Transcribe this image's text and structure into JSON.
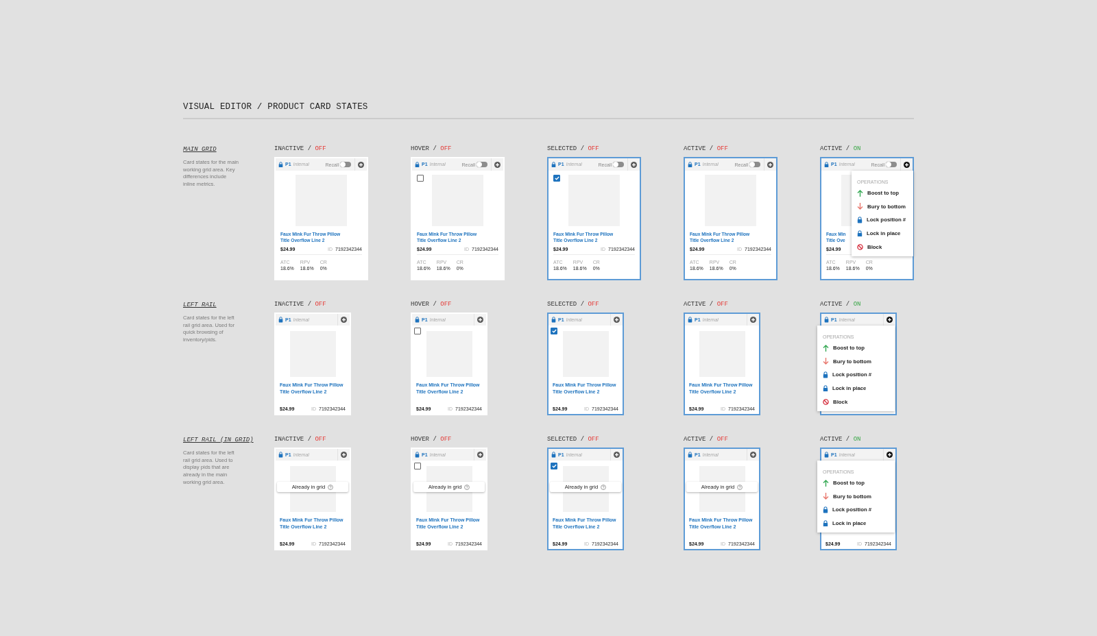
{
  "title": "VISUAL EDITOR / PRODUCT CARD STATES",
  "sections": [
    {
      "kind": "main",
      "name": "MAIN GRID",
      "description": "Card states for the main working grid area. Key differences include inline metrics.",
      "cards": [
        {
          "state": "INACTIVE",
          "divider": "/",
          "status": "OFF",
          "on": false,
          "outlined": false,
          "tag": "P1",
          "tag_note": "Internal",
          "recall": {
            "label": "Recall",
            "on": false
          },
          "title": [
            "Faux Mink Fur Throw Pillow",
            "Title Overflow Line 2"
          ],
          "price": "$24.99",
          "id_label": "ID",
          "id": "7192342344",
          "metrics": [
            {
              "label": "ATC",
              "value": "18.6%"
            },
            {
              "label": "RPV",
              "value": "18.6%"
            },
            {
              "label": "CR",
              "value": "0%"
            }
          ]
        },
        {
          "state": "HOVER",
          "divider": "/",
          "status": "OFF",
          "on": false,
          "outlined": false,
          "checkbox": {
            "checked": false
          },
          "tag": "P1",
          "tag_note": "Internal",
          "recall": {
            "label": "Recall",
            "on": false
          },
          "title": [
            "Faux Mink Fur Throw Pillow",
            "Title Overflow Line 2"
          ],
          "price": "$24.99",
          "id_label": "ID",
          "id": "7192342344",
          "metrics": [
            {
              "label": "ATC",
              "value": "18.6%"
            },
            {
              "label": "RPV",
              "value": "18.6%"
            },
            {
              "label": "CR",
              "value": "0%"
            }
          ]
        },
        {
          "state": "SELECTED",
          "divider": "/",
          "status": "OFF",
          "on": false,
          "outlined": true,
          "checkbox": {
            "checked": true
          },
          "tag": "P1",
          "tag_note": "Internal",
          "recall": {
            "label": "Recall",
            "on": false
          },
          "title": [
            "Faux Mink Fur Throw Pillow",
            "Title Overflow Line 2"
          ],
          "price": "$24.99",
          "id_label": "ID",
          "id": "7192342344",
          "metrics": [
            {
              "label": "ATC",
              "value": "18.6%"
            },
            {
              "label": "RPV",
              "value": "18.6%"
            },
            {
              "label": "CR",
              "value": "0%"
            }
          ]
        },
        {
          "state": "ACTIVE",
          "divider": "/",
          "status": "OFF",
          "on": false,
          "outlined": true,
          "tag": "P1",
          "tag_note": "Internal",
          "recall": {
            "label": "Recall",
            "on": false
          },
          "title": [
            "Faux Mink Fur Throw Pillow",
            "Title Overflow Line 2"
          ],
          "price": "$24.99",
          "id_label": "ID",
          "id": "7192342344",
          "metrics": [
            {
              "label": "ATC",
              "value": "18.6%"
            },
            {
              "label": "RPV",
              "value": "18.6%"
            },
            {
              "label": "CR",
              "value": "0%"
            }
          ]
        },
        {
          "state": "ACTIVE",
          "divider": "/",
          "status": "ON",
          "on": true,
          "outlined": true,
          "tag": "P1",
          "tag_note": "Internal",
          "recall": {
            "label": "Recall",
            "on": false
          },
          "title": [
            "Faux Min",
            "Title Ove"
          ],
          "price": "$24.99",
          "metrics": [
            {
              "label": "ATC",
              "value": "18.6%"
            },
            {
              "label": "RPV",
              "value": "18.6%"
            },
            {
              "label": "CR",
              "value": "0%"
            }
          ],
          "menu": {
            "title": "OPERATIONS",
            "items": [
              {
                "kind": "boost",
                "label": "Boost to top"
              },
              {
                "kind": "bury",
                "label": "Bury to bottom"
              },
              {
                "kind": "lock",
                "label": "Lock position #"
              },
              {
                "kind": "lock",
                "label": "Lock in place"
              },
              {
                "kind": "block",
                "label": "Block"
              }
            ]
          }
        }
      ]
    },
    {
      "kind": "rail",
      "name": "LEFT RAIL",
      "description": "Card states for the left rail grid area. Used for quick browsing of inventory/pids.",
      "cards": [
        {
          "state": "INACTIVE",
          "divider": "/",
          "status": "OFF",
          "on": false,
          "outlined": false,
          "tag": "P1",
          "tag_note": "Internal",
          "title": [
            "Faux Mink Fur Throw Pillow",
            "Title Overflow Line 2"
          ],
          "price": "$24.99",
          "id_label": "ID",
          "id": "7192342344"
        },
        {
          "state": "HOVER",
          "divider": "/",
          "status": "OFF",
          "on": false,
          "outlined": false,
          "checkbox": {
            "checked": false
          },
          "tag": "P1",
          "tag_note": "Internal",
          "title": [
            "Faux Mink Fur Throw Pillow",
            "Title Overflow Line 2"
          ],
          "price": "$24.99",
          "id_label": "ID",
          "id": "7192342344"
        },
        {
          "state": "SELECTED",
          "divider": "/",
          "status": "OFF",
          "on": false,
          "outlined": true,
          "checkbox": {
            "checked": true
          },
          "tag": "P1",
          "tag_note": "Internal",
          "title": [
            "Faux Mink Fur Throw Pillow",
            "Title Overflow Line 2"
          ],
          "price": "$24.99",
          "id_label": "ID",
          "id": "7192342344"
        },
        {
          "state": "ACTIVE",
          "divider": "/",
          "status": "OFF",
          "on": false,
          "outlined": true,
          "tag": "P1",
          "tag_note": "Internal",
          "title": [
            "Faux Mink Fur Throw Pillow",
            "Title Overflow Line 2"
          ],
          "price": "$24.99",
          "id_label": "ID",
          "id": "7192342344"
        },
        {
          "state": "ACTIVE",
          "divider": "/",
          "status": "ON",
          "on": true,
          "outlined": true,
          "tag": "P1",
          "tag_note": "Internal",
          "menu": {
            "title": "OPERATIONS",
            "items": [
              {
                "kind": "boost",
                "label": "Boost to top"
              },
              {
                "kind": "bury",
                "label": "Bury to bottom"
              },
              {
                "kind": "lock",
                "label": "Lock position #"
              },
              {
                "kind": "lock",
                "label": "Lock in place"
              },
              {
                "kind": "block",
                "label": "Block"
              }
            ]
          }
        }
      ]
    },
    {
      "kind": "rail",
      "name": "LEFT RAIL (IN GRID)",
      "description": "Card states for the left rail grid area. Used to display pids that are already in the main working grid area.",
      "cards": [
        {
          "state": "INACTIVE",
          "divider": "/",
          "status": "OFF",
          "on": false,
          "outlined": false,
          "tag": "P1",
          "tag_note": "Internal",
          "notice": "Already in grid",
          "title": [
            "Faux Mink Fur Throw Pillow",
            "Title Overflow Line 2"
          ],
          "price": "$24.99",
          "id_label": "ID",
          "id": "7192342344"
        },
        {
          "state": "HOVER",
          "divider": "/",
          "status": "OFF",
          "on": false,
          "outlined": false,
          "checkbox": {
            "checked": false
          },
          "tag": "P1",
          "tag_note": "Internal",
          "notice": "Already in grid",
          "title": [
            "Faux Mink Fur Throw Pillow",
            "Title Overflow Line 2"
          ],
          "price": "$24.99",
          "id_label": "ID",
          "id": "7192342344"
        },
        {
          "state": "SELECTED",
          "divider": "/",
          "status": "OFF",
          "on": false,
          "outlined": true,
          "checkbox": {
            "checked": true
          },
          "tag": "P1",
          "tag_note": "Internal",
          "notice": "Already in grid",
          "title": [
            "Faux Mink Fur Throw Pillow",
            "Title Overflow Line 2"
          ],
          "price": "$24.99",
          "id_label": "ID",
          "id": "7192342344"
        },
        {
          "state": "ACTIVE",
          "divider": "/",
          "status": "OFF",
          "on": false,
          "outlined": true,
          "tag": "P1",
          "tag_note": "Internal",
          "notice": "Already in grid",
          "title": [
            "Faux Mink Fur Throw Pillow",
            "Title Overflow Line 2"
          ],
          "price": "$24.99",
          "id_label": "ID",
          "id": "7192342344"
        },
        {
          "state": "ACTIVE",
          "divider": "/",
          "status": "ON",
          "on": true,
          "outlined": true,
          "tag": "P1",
          "tag_note": "Internal",
          "price": "$24.99",
          "id_label": "ID",
          "id": "7192342344",
          "menu": {
            "title": "OPERATIONS",
            "items": [
              {
                "kind": "boost",
                "label": "Boost to top"
              },
              {
                "kind": "bury",
                "label": "Bury to bottom"
              },
              {
                "kind": "lock",
                "label": "Lock position #"
              },
              {
                "kind": "lock",
                "label": "Lock in place"
              }
            ]
          }
        }
      ]
    }
  ]
}
